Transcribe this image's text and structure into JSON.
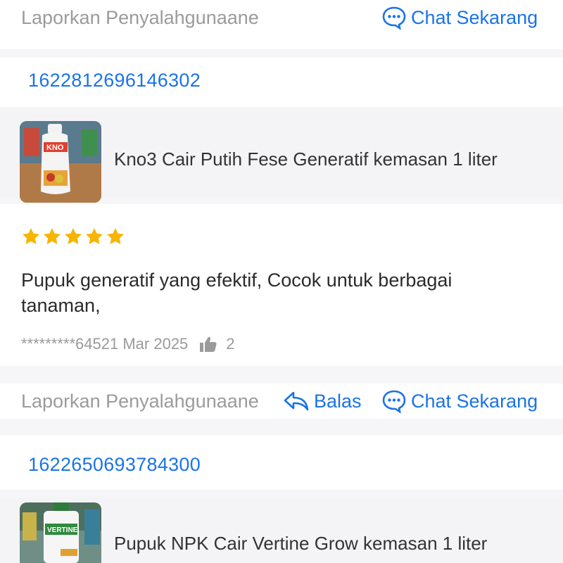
{
  "colors": {
    "accent": "#1a73e8",
    "star": "#f7b500",
    "muted": "#9a9a9a",
    "text": "#2b2b2b"
  },
  "top_actions": {
    "report_label": "Laporkan Penyalahgunaane",
    "chat_label": "Chat Sekarang",
    "chat_icon": "chat-bubble-icon"
  },
  "reviews": [
    {
      "order_id": "1622812696146302",
      "product_name": "Kno3 Cair Putih Fese Generatif kemasan 1 liter",
      "product_image": "kno3-bottle-thumbnail",
      "rating": 5,
      "review_text": "Pupuk generatif yang efektif, Cocok untuk berbagai tanaman,",
      "user_masked": "*********6452",
      "date": "1 Mar 2025",
      "likes": "2",
      "like_icon": "thumbs-up-icon",
      "report_label": "Laporkan Penyalahgunaane",
      "reply_label": "Balas",
      "reply_icon": "reply-arrow-icon",
      "chat_label": "Chat Sekarang",
      "chat_icon": "chat-bubble-icon"
    },
    {
      "order_id": "1622650693784300",
      "product_name": "Pupuk NPK Cair Vertine Grow kemasan 1 liter",
      "product_image": "vertine-grow-bottle-thumbnail"
    }
  ]
}
